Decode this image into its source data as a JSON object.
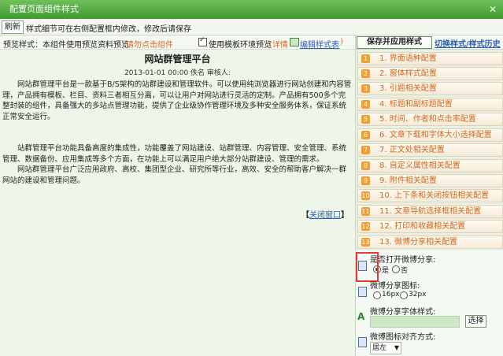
{
  "window": {
    "title": "配置页面组件样式",
    "close_glyph": "✕"
  },
  "toolbar": {
    "refresh_label": "刷新",
    "hint": "样式细节可在右侧配置框内修改，修改后请保存"
  },
  "preview": {
    "style_label": "预览样式：本组件使用预览资料预览",
    "click_component": "请勿点击组件",
    "use_template_label": "使用模板环境预览",
    "details_link": "(详情",
    "edit_style_link": "编辑样式表",
    "close_paren": ")",
    "use_template_checked": true
  },
  "article": {
    "title": "网站群管理平台",
    "meta": "2013-01-01 00:00  佚名    审核人:",
    "p1": "网站群管理平台是一款基于B/S架构的站群建设和管理软件。可以使用纯浏览器进行网站创建和内容管理，产品拥有模板、栏目、资料三者相互分离，可以让用户对网站进行灵活的定制。产品拥有500多个完整封装的组件，具备强大的多站点管理功能，提供了企业级协作管理环境及多种安全服务体系，保证系统正常安全运行。",
    "p2": "站群管理平台功能具备高度的集成性，功能覆盖了网站建设、站群管理、内容管理、安全管理、系统管理、数据备份、应用集成等多个方面，在功能上可以满足用户绝大部分站群建设、管理的需求。",
    "p3": "网站群管理平台广泛应用政府、高校、集团型企业、研究所等行业，高效、安全的帮助客户解决一群网站的建设和管理问题。",
    "close_window_open": "【",
    "close_window": "关闭窗口",
    "close_window_close": "】"
  },
  "rightpanel": {
    "save_button": "保存并应用样式",
    "switch_link": "切换样式/样式历史",
    "menu_items": [
      {
        "num": "1",
        "label": "1.  界面语种配置"
      },
      {
        "num": "2",
        "label": "2.  窗体样式配置"
      },
      {
        "num": "3",
        "label": "3.  引题相关配置"
      },
      {
        "num": "4",
        "label": "4.  标题和副标题配置"
      },
      {
        "num": "5",
        "label": "5.  时间、作者和点击率配置"
      },
      {
        "num": "6",
        "label": "6.  文章下载和字体大小选择配置"
      },
      {
        "num": "7",
        "label": "7.  正文处相关配置"
      },
      {
        "num": "8",
        "label": "8.  自定义属性相关配置"
      },
      {
        "num": "9",
        "label": "9.  附件相关配置"
      },
      {
        "num": "10",
        "label": "10.  上下条和关闭按钮相关配置"
      },
      {
        "num": "11",
        "label": "11.  文章导航选择框相关配置"
      },
      {
        "num": "12",
        "label": "12.  打印和收藏相关配置"
      },
      {
        "num": "13",
        "label": "13.  微博分享相关配置"
      }
    ],
    "settings": {
      "weibo_share_label": "是否打开微博分享:",
      "yes_label": "是",
      "no_label": "否",
      "yes_selected": true,
      "icon_label": "微博分享图标:",
      "icon_16": "16px",
      "icon_32": "32px",
      "font_style_label": "微博分享字体样式:",
      "font_style_value": "",
      "select_button": "选择",
      "align_label": "微博图标对齐方式:",
      "align_value": "居左"
    }
  }
}
